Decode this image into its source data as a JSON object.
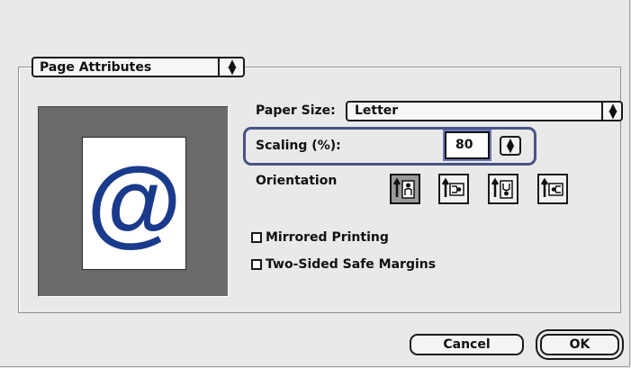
{
  "section_popup": {
    "label": "Page Attributes"
  },
  "paper_size": {
    "label": "Paper Size:",
    "value": "Letter"
  },
  "scaling": {
    "label": "Scaling (%):",
    "value": "80"
  },
  "orientation": {
    "label": "Orientation",
    "options": [
      {
        "name": "portrait",
        "selected": true
      },
      {
        "name": "landscape",
        "selected": false
      },
      {
        "name": "reverse-portrait",
        "selected": false
      },
      {
        "name": "reverse-landscape",
        "selected": false
      }
    ]
  },
  "checkboxes": {
    "mirrored_printing": {
      "label": "Mirrored Printing",
      "checked": false
    },
    "two_sided_safe_margins": {
      "label": "Two-Sided Safe Margins",
      "checked": false
    }
  },
  "buttons": {
    "cancel": "Cancel",
    "ok": "OK"
  },
  "preview": {
    "symbol": "@",
    "symbol_color": "#1a3a8c"
  },
  "colors": {
    "highlight": "#4a5286"
  }
}
